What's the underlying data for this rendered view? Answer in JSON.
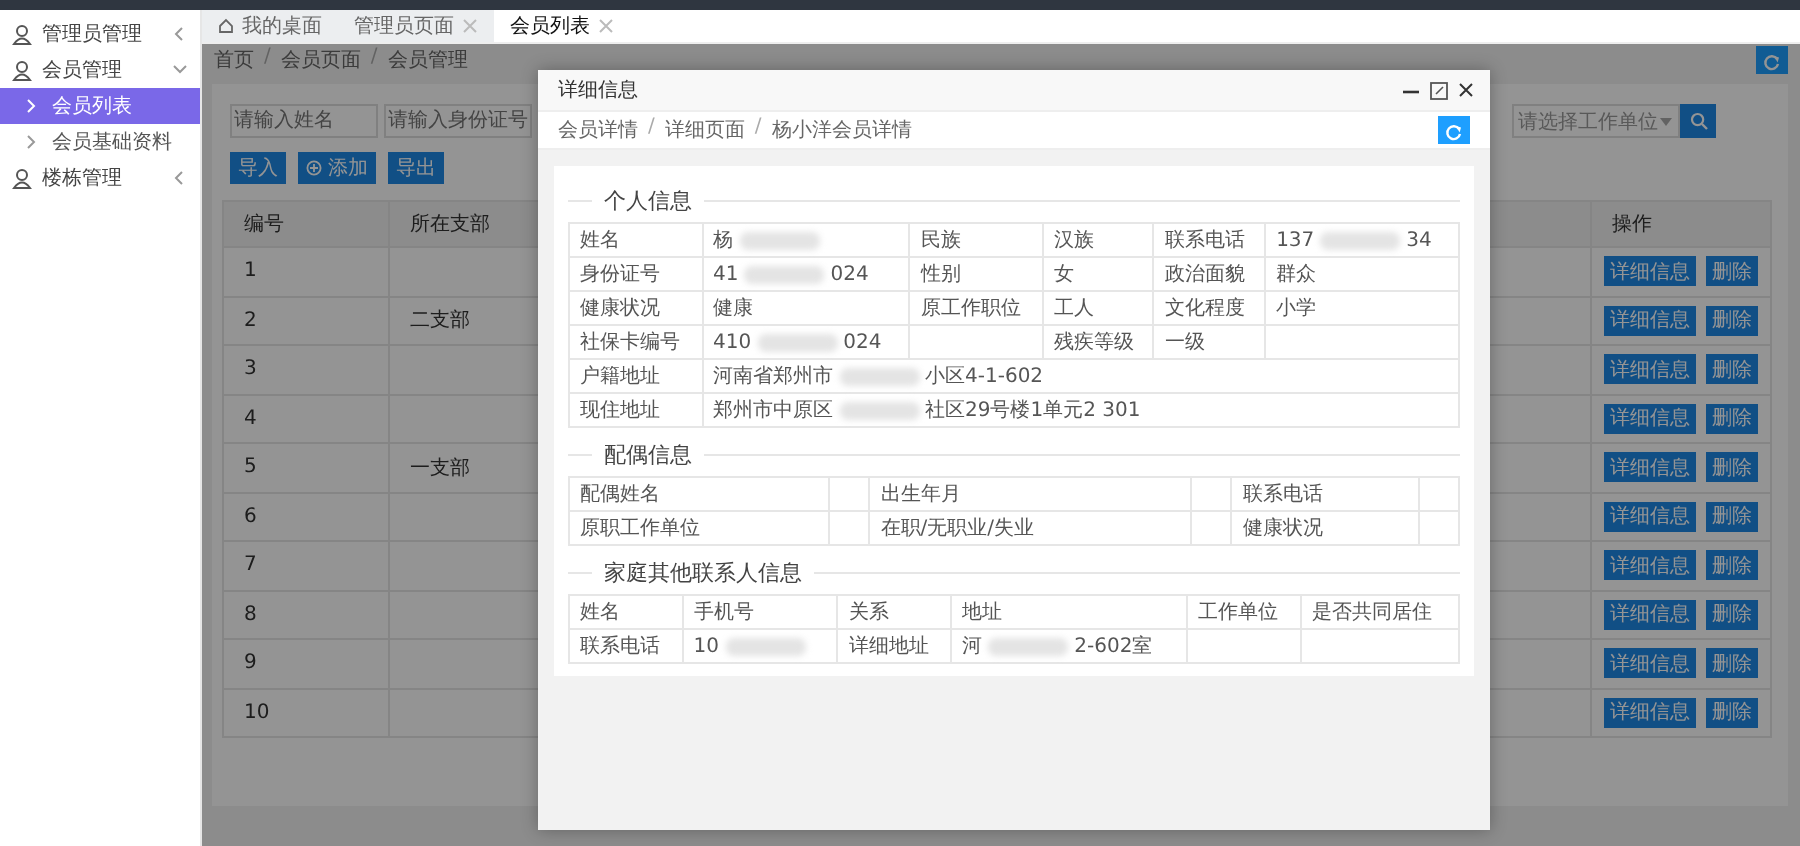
{
  "sidebar": {
    "items": [
      {
        "label": "管理员管理",
        "expanded": false
      },
      {
        "label": "会员管理",
        "expanded": true,
        "children": [
          {
            "label": "会员列表",
            "selected": true
          },
          {
            "label": "会员基础资料",
            "selected": false
          }
        ]
      },
      {
        "label": "楼栋管理",
        "expanded": false
      }
    ]
  },
  "tabs": [
    {
      "label": "我的桌面",
      "kind": "home",
      "selected": false
    },
    {
      "label": "管理员页面",
      "kind": "page",
      "selected": false
    },
    {
      "label": "会员列表",
      "kind": "page",
      "selected": true
    }
  ],
  "breadcrumb": {
    "separator": "/",
    "items": [
      "首页",
      "会员页面",
      "会员管理"
    ]
  },
  "filters": [
    {
      "kind": "input",
      "placeholder": "请输入姓名"
    },
    {
      "kind": "input",
      "placeholder": "请输入身份证号"
    },
    {
      "kind": "select",
      "placeholder": "请选择工作单位"
    }
  ],
  "toolbar": [
    {
      "label": "导入",
      "kind": "plain"
    },
    {
      "label": "添加",
      "kind": "add"
    },
    {
      "label": "导出",
      "kind": "plain"
    }
  ],
  "table": {
    "columns": [
      "编号",
      "所在支部",
      "操作"
    ],
    "rows": [
      {
        "number": "1",
        "actions": [
          "详细信息",
          "删除"
        ]
      },
      {
        "number": "2",
        "branch": "二支部",
        "actions": [
          "详细信息",
          "删除"
        ]
      },
      {
        "number": "3",
        "actions": [
          "详细信息",
          "删除"
        ]
      },
      {
        "number": "4",
        "actions": [
          "详细信息",
          "删除"
        ]
      },
      {
        "number": "5",
        "branch": "一支部",
        "actions": [
          "详细信息",
          "删除"
        ]
      },
      {
        "number": "6",
        "actions": [
          "详细信息",
          "删除"
        ]
      },
      {
        "number": "7",
        "actions": [
          "详细信息",
          "删除"
        ]
      },
      {
        "number": "8",
        "actions": [
          "详细信息",
          "删除"
        ]
      },
      {
        "number": "9",
        "actions": [
          "详细信息",
          "删除"
        ]
      },
      {
        "number": "10",
        "actions": [
          "详细信息",
          "删除"
        ]
      }
    ]
  },
  "dialog": {
    "title": "详细信息",
    "breadcrumb": {
      "separator": "/",
      "items": [
        "会员详情",
        "详细页面",
        "杨小洋会员详情"
      ]
    },
    "sections": [
      {
        "title": "个人信息",
        "rows": [
          {
            "cells": [
              "姓名",
              {
                "parts": [
                  "杨"
                ]
              },
              "民族",
              "汉族",
              "联系电话",
              {
                "parts": [
                  "137",
                  "34"
                ]
              }
            ]
          },
          {
            "cells": [
              "身份证号",
              {
                "parts": [
                  "41",
                  "024"
                ]
              },
              "性别",
              "女",
              "政治面貌",
              "群众"
            ]
          },
          {
            "cells": [
              "健康状况",
              "健康",
              "原工作职位",
              "工人",
              "文化程度",
              "小学"
            ]
          },
          {
            "cells": [
              "社保卡编号",
              {
                "parts": [
                  "410",
                  "024"
                ]
              },
              null,
              "残疾等级",
              "一级",
              null
            ]
          },
          {
            "cells": [
              "户籍地址",
              {
                "parts": [
                  "河南省郑州市",
                  "小区4-1-602"
                ],
                "colspan": 5
              }
            ]
          },
          {
            "cells": [
              "现住地址",
              {
                "parts": [
                  "郑州市中原区",
                  "社区29号楼1单元2 301"
                ],
                "colspan": 5
              }
            ]
          }
        ]
      },
      {
        "title": "配偶信息",
        "rows": [
          {
            "cells": [
              "配偶姓名",
              null,
              "出生年月",
              null,
              "联系电话",
              null
            ]
          },
          {
            "cells": [
              "原职工作单位",
              null,
              "在职/无职业/失业",
              null,
              "健康状况",
              null
            ]
          }
        ]
      },
      {
        "title": "家庭其他联系人信息",
        "rows": [
          {
            "cells": [
              "姓名",
              "手机号",
              "关系",
              "地址",
              "工作单位",
              "是否共同居住"
            ]
          },
          {
            "cells": [
              "联系电话",
              {
                "parts": [
                  "10"
                ]
              },
              "详细地址",
              {
                "parts": [
                  "河",
                  "2-602室"
                ]
              },
              null,
              null
            ]
          }
        ]
      }
    ]
  }
}
